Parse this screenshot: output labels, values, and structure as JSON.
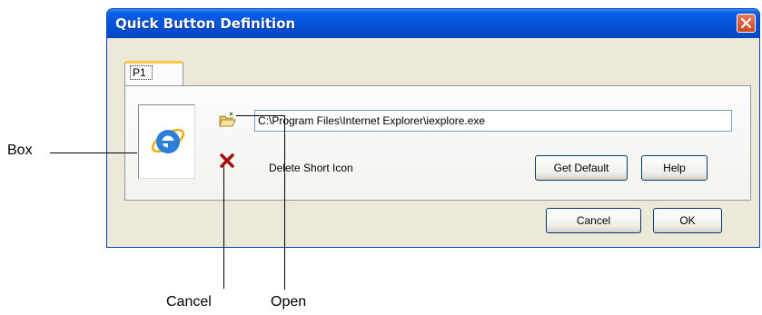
{
  "dialog": {
    "title": "Quick Button Definition",
    "tab_label": "P1",
    "path_value": "C:\\Program Files\\Internet Explorer\\iexplore.exe",
    "delete_label": "Delete Short Icon",
    "buttons": {
      "get_default": "Get Default",
      "help": "Help",
      "cancel": "Cancel",
      "ok": "OK"
    }
  },
  "callouts": {
    "box": "Box",
    "cancel": "Cancel",
    "open": "Open"
  },
  "icons": {
    "close": "close-icon",
    "program": "internet-explorer-icon",
    "open": "open-folder-icon",
    "delete": "delete-x-icon"
  },
  "colors": {
    "titlebar": "#0552d8",
    "dialog_bg": "#ece9d8",
    "tab_accent": "#ffc83c",
    "delete_x": "#a51010"
  }
}
